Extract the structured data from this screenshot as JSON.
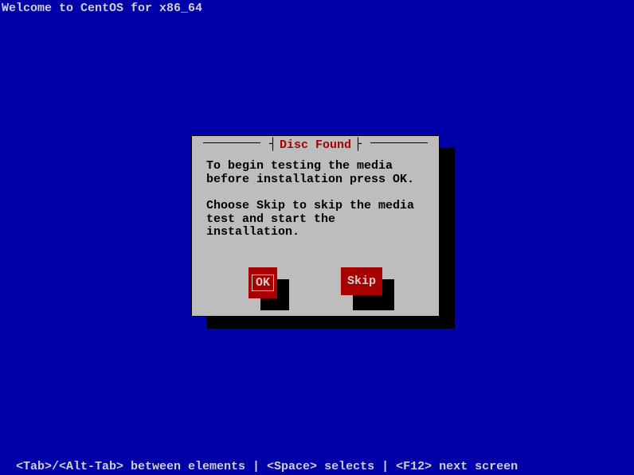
{
  "header": "Welcome to CentOS for x86_64",
  "dialog": {
    "title": "Disc Found",
    "body_line1": "To begin testing the media before installation press OK.",
    "body_line2": "Choose Skip to skip the media test and start the installation.",
    "ok_label": "OK",
    "skip_label": "Skip"
  },
  "footer": "<Tab>/<Alt-Tab> between elements  | <Space> selects | <F12> next screen"
}
